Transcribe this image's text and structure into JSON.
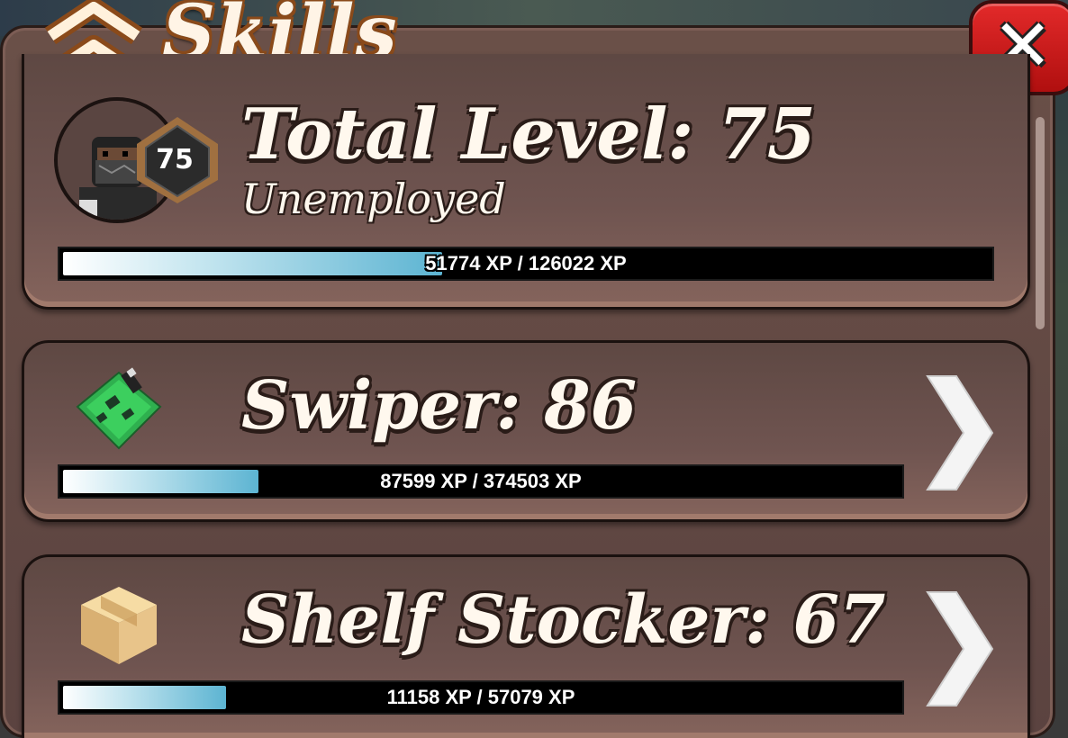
{
  "window": {
    "title": "Skills",
    "close_label": "✕"
  },
  "total": {
    "title": "Total Level: 75",
    "level_badge": "75",
    "job": "Unemployed",
    "xp_text": "51774 XP / 126022 XP",
    "progress": 0.41
  },
  "skills": [
    {
      "title": "Swiper: 86",
      "xp_text": "87599 XP / 374503 XP",
      "progress": 0.234,
      "icon": "circuit-board-icon"
    },
    {
      "title": "Shelf Stocker: 67",
      "xp_text": "11158 XP / 57079 XP",
      "progress": 0.195,
      "icon": "cardboard-box-icon"
    }
  ],
  "colors": {
    "panel": "#5b4340",
    "close": "#d01818",
    "xp_fill": "#5cb4d2",
    "title_outline": "#8a4a1a"
  }
}
